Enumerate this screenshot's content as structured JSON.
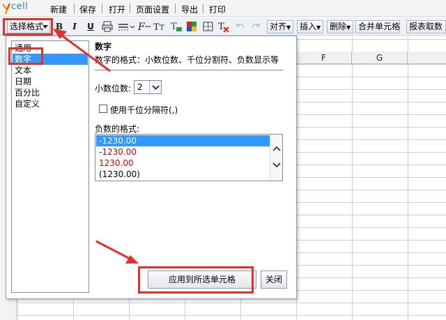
{
  "app": {
    "logo_text": "cell"
  },
  "menu": {
    "items": [
      "新建",
      "保存",
      "打开",
      "页面设置",
      "导出",
      "打印"
    ]
  },
  "toolbar": {
    "format_select": "选择格式",
    "bold": "B",
    "italic": "I",
    "underline": "U",
    "align": "对齐",
    "insert": "插入",
    "delete": "删除",
    "merge": "合并单元格",
    "report": "报表取数"
  },
  "grid": {
    "columns": [
      "F",
      "G"
    ]
  },
  "panel": {
    "categories": [
      "通用",
      "数字",
      "文本",
      "日期",
      "百分比",
      "自定义"
    ],
    "selected_category": "数字",
    "section_title": "数字",
    "section_desc": "数字的格式：小数位数、千位分割符、负数显示等",
    "decimals_label": "小数位数:",
    "decimals_value": "2",
    "thousands_label": "使用千位分隔符(,)",
    "negative_label": "负数的格式:",
    "negative_formats": [
      {
        "text": "-1230.00",
        "color": "#ffffff"
      },
      {
        "text": "-1230.00",
        "color": "#d40000"
      },
      {
        "text": "1230.00",
        "color": "#d40000"
      },
      {
        "text": "(1230.00)",
        "color": "#000000"
      }
    ],
    "apply_button": "应用到所选单元格",
    "close_button": "关闭"
  },
  "colors": {
    "highlight": "#e2302b",
    "selection": "#3399ff"
  },
  "icons": [
    "print-icon",
    "border-icon",
    "font-icon",
    "text-size-icon",
    "text-color-icon",
    "fill-color-icon",
    "cell-border-icon",
    "clear-format-icon",
    "undo-icon",
    "redo-icon"
  ]
}
